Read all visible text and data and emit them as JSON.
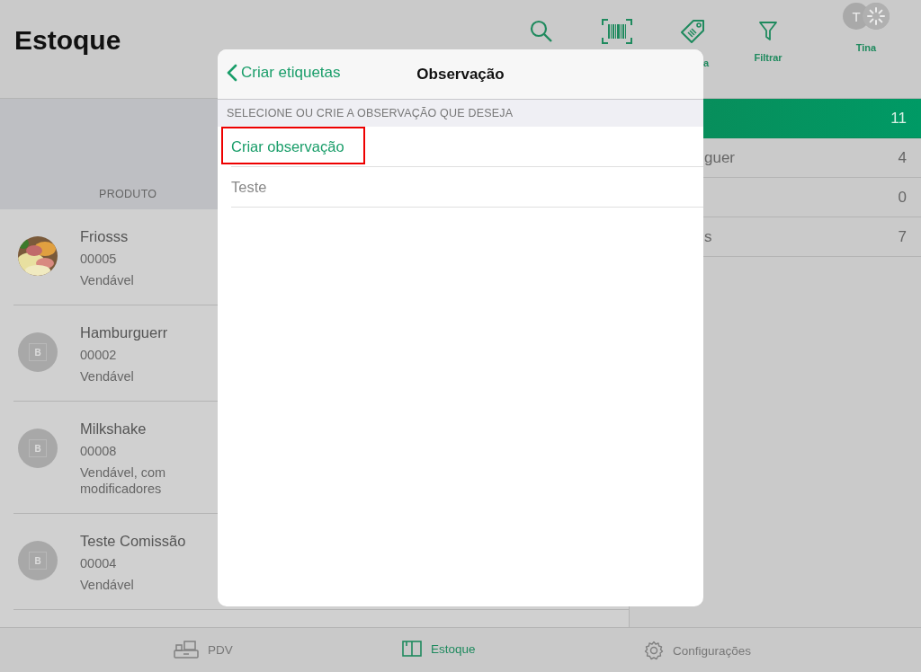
{
  "header": {
    "title": "Estoque",
    "toolbar": [
      {
        "kind": "search"
      },
      {
        "kind": "barcode"
      },
      {
        "kind": "tag",
        "label": "a"
      },
      {
        "kind": "filter",
        "label": "Filtrar"
      }
    ],
    "user": {
      "initial": "T",
      "name": "Tina",
      "loading": true
    }
  },
  "products": {
    "column_header": "PRODUTO",
    "rows": [
      {
        "name": "Friosss",
        "code": "00005",
        "status": "Vendável",
        "kind": "picture"
      },
      {
        "name": "Hamburguerr",
        "code": "00002",
        "status": "Vendável",
        "kind": "placeholder",
        "placeholder_letter": "B"
      },
      {
        "name": "Milkshake",
        "code": "00008",
        "status": "Vendável, com modificadores",
        "kind": "placeholder",
        "placeholder_letter": "B"
      },
      {
        "name": "Teste Comissão",
        "code": "00004",
        "status": "Vendável",
        "kind": "placeholder",
        "placeholder_letter": "B"
      }
    ]
  },
  "categories": [
    {
      "count": "11",
      "selected": true
    },
    {
      "name": "guer",
      "count": "4",
      "selected": false
    },
    {
      "count": "0",
      "selected": false
    },
    {
      "name": "s",
      "count": "7",
      "selected": false
    }
  ],
  "modal": {
    "back_label": "Criar etiquetas",
    "title": "Observação",
    "section_header": "SELECIONE OU CRIE A OBSERVAÇÃO QUE DESEJA",
    "rows": [
      {
        "label": "Criar observação",
        "kind": "action",
        "highlighted": true
      },
      {
        "label": "Teste",
        "kind": "option",
        "highlighted": false
      }
    ]
  },
  "tab_bar": [
    {
      "kind": "pos",
      "label": "PDV",
      "selected": false
    },
    {
      "kind": "stock",
      "label": "Estoque",
      "selected": true
    },
    {
      "kind": "settings",
      "label": "Configurações",
      "selected": false
    }
  ]
}
